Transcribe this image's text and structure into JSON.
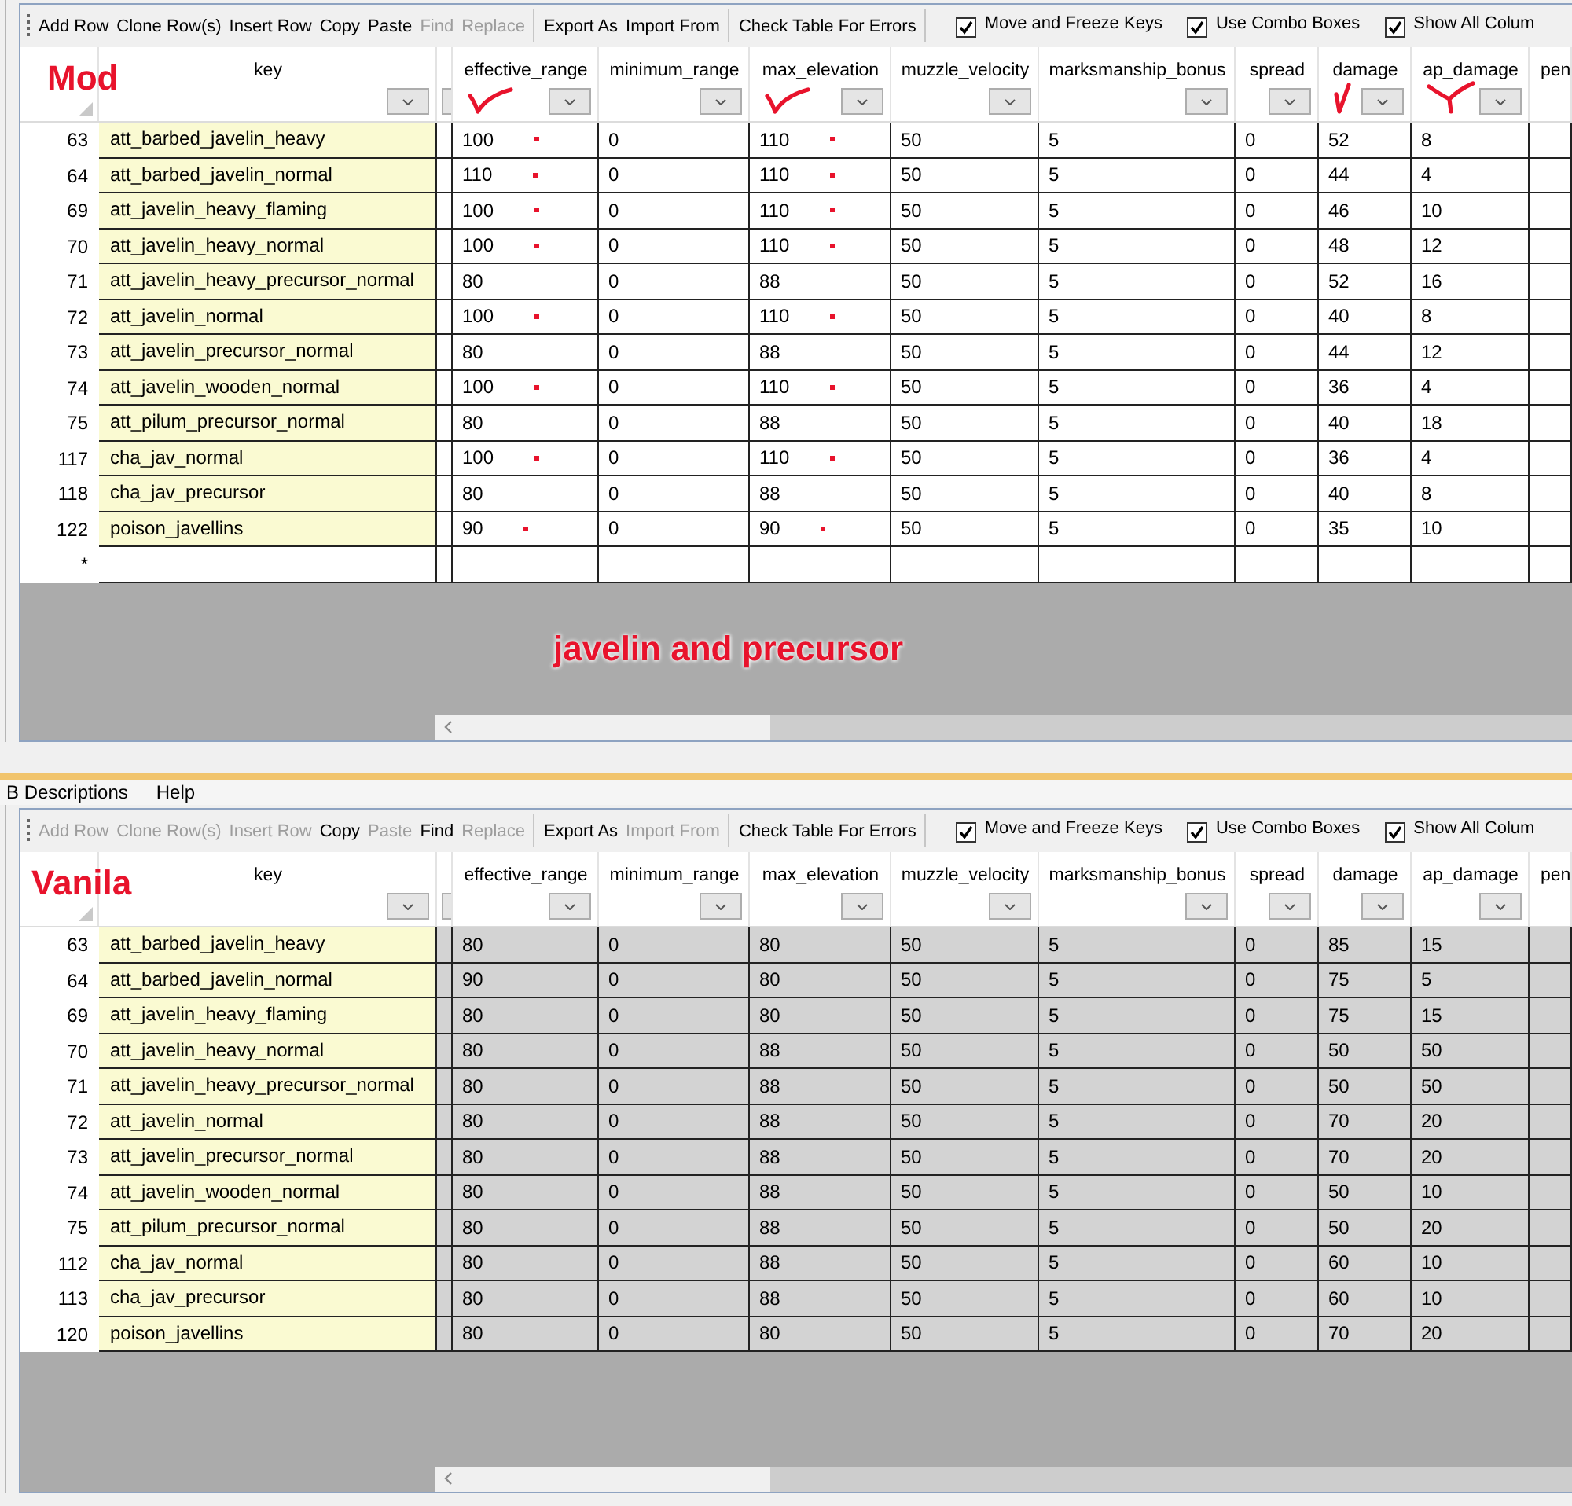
{
  "sections": [
    {
      "kind": "table_panel",
      "annotation": "Mod",
      "read_only": false,
      "toolbar": {
        "groups": [
          [
            {
              "label": "Add Row",
              "disabled": false
            },
            {
              "label": "Clone Row(s)",
              "disabled": false
            },
            {
              "label": "Insert Row",
              "disabled": false
            },
            {
              "label": "Copy",
              "disabled": false
            },
            {
              "label": "Paste",
              "disabled": false
            },
            {
              "label": "Find",
              "disabled": true
            },
            {
              "label": "Replace",
              "disabled": true
            }
          ],
          [
            {
              "label": "Export As",
              "disabled": false
            },
            {
              "label": "Import From",
              "disabled": false
            }
          ],
          [
            {
              "label": "Check Table For Errors",
              "disabled": false
            }
          ]
        ],
        "checkboxes": [
          {
            "label": "Move and Freeze Keys",
            "checked": true
          },
          {
            "label": "Use Combo Boxes",
            "checked": true
          },
          {
            "label": "Show All Colum",
            "checked": true
          }
        ]
      },
      "columns": [
        {
          "kind": "key",
          "label": "key",
          "filter": true
        },
        {
          "kind": "blank",
          "filter": true
        },
        {
          "kind": "value",
          "label": "effective_range",
          "filter": true,
          "mark": {
            "kind": "tick"
          }
        },
        {
          "kind": "value",
          "label": "minimum_range",
          "filter": true
        },
        {
          "kind": "value",
          "label": "max_elevation",
          "filter": true,
          "mark": {
            "kind": "tick"
          }
        },
        {
          "kind": "value",
          "label": "muzzle_velocity",
          "filter": true
        },
        {
          "kind": "value",
          "label": "marksmanship_bonus",
          "filter": true
        },
        {
          "kind": "value",
          "label": "spread",
          "filter": true
        },
        {
          "kind": "value",
          "label": "damage",
          "filter": true,
          "mark": {
            "kind": "slash"
          }
        },
        {
          "kind": "value",
          "label": "ap_damage",
          "filter": true,
          "mark": {
            "kind": "fork"
          }
        },
        {
          "kind": "blank",
          "label": "pen",
          "filter": false
        }
      ],
      "rows": [
        {
          "number": "63",
          "key": "att_barbed_javelin_heavy",
          "values": [
            "100",
            "0",
            "110",
            "50",
            "5",
            "0",
            "52",
            "8"
          ],
          "marked": true
        },
        {
          "number": "64",
          "key": "att_barbed_javelin_normal",
          "values": [
            "110",
            "0",
            "110",
            "50",
            "5",
            "0",
            "44",
            "4"
          ],
          "marked": true
        },
        {
          "number": "69",
          "key": "att_javelin_heavy_flaming",
          "values": [
            "100",
            "0",
            "110",
            "50",
            "5",
            "0",
            "46",
            "10"
          ],
          "marked": true
        },
        {
          "number": "70",
          "key": "att_javelin_heavy_normal",
          "values": [
            "100",
            "0",
            "110",
            "50",
            "5",
            "0",
            "48",
            "12"
          ],
          "marked": true
        },
        {
          "number": "71",
          "key": "att_javelin_heavy_precursor_normal",
          "values": [
            "80",
            "0",
            "88",
            "50",
            "5",
            "0",
            "52",
            "16"
          ],
          "marked": false
        },
        {
          "number": "72",
          "key": "att_javelin_normal",
          "values": [
            "100",
            "0",
            "110",
            "50",
            "5",
            "0",
            "40",
            "8"
          ],
          "marked": true
        },
        {
          "number": "73",
          "key": "att_javelin_precursor_normal",
          "values": [
            "80",
            "0",
            "88",
            "50",
            "5",
            "0",
            "44",
            "12"
          ],
          "marked": false
        },
        {
          "number": "74",
          "key": "att_javelin_wooden_normal",
          "values": [
            "100",
            "0",
            "110",
            "50",
            "5",
            "0",
            "36",
            "4"
          ],
          "marked": true
        },
        {
          "number": "75",
          "key": "att_pilum_precursor_normal",
          "values": [
            "80",
            "0",
            "88",
            "50",
            "5",
            "0",
            "40",
            "18"
          ],
          "marked": false
        },
        {
          "number": "117",
          "key": "cha_jav_normal",
          "values": [
            "100",
            "0",
            "110",
            "50",
            "5",
            "0",
            "36",
            "4"
          ],
          "marked": true
        },
        {
          "number": "118",
          "key": "cha_jav_precursor",
          "values": [
            "80",
            "0",
            "88",
            "50",
            "5",
            "0",
            "40",
            "8"
          ],
          "marked": false
        },
        {
          "number": "122",
          "key": "poison_javellins",
          "values": [
            "90",
            "0",
            "90",
            "50",
            "5",
            "0",
            "35",
            "10"
          ],
          "marked": true
        }
      ],
      "new_row": {
        "marker": "*"
      },
      "note": "javelin and precursor"
    },
    {
      "kind": "menu_strip",
      "items": [
        {
          "label": "B Descriptions"
        },
        {
          "label": "Help"
        }
      ]
    },
    {
      "kind": "table_panel",
      "annotation": "Vanila",
      "read_only": true,
      "toolbar": {
        "groups": [
          [
            {
              "label": "Add Row",
              "disabled": true
            },
            {
              "label": "Clone Row(s)",
              "disabled": true
            },
            {
              "label": "Insert Row",
              "disabled": true
            },
            {
              "label": "Copy",
              "disabled": false
            },
            {
              "label": "Paste",
              "disabled": true
            },
            {
              "label": "Find",
              "disabled": false
            },
            {
              "label": "Replace",
              "disabled": true
            }
          ],
          [
            {
              "label": "Export As",
              "disabled": false
            },
            {
              "label": "Import From",
              "disabled": true
            }
          ],
          [
            {
              "label": "Check Table For Errors",
              "disabled": false
            }
          ]
        ],
        "checkboxes": [
          {
            "label": "Move and Freeze Keys",
            "checked": true
          },
          {
            "label": "Use Combo Boxes",
            "checked": true
          },
          {
            "label": "Show All Colum",
            "checked": true
          }
        ]
      },
      "columns": [
        {
          "kind": "key",
          "label": "key",
          "filter": true
        },
        {
          "kind": "blank",
          "filter": true
        },
        {
          "kind": "value",
          "label": "effective_range",
          "filter": true
        },
        {
          "kind": "value",
          "label": "minimum_range",
          "filter": true
        },
        {
          "kind": "value",
          "label": "max_elevation",
          "filter": true
        },
        {
          "kind": "value",
          "label": "muzzle_velocity",
          "filter": true
        },
        {
          "kind": "value",
          "label": "marksmanship_bonus",
          "filter": true
        },
        {
          "kind": "value",
          "label": "spread",
          "filter": true
        },
        {
          "kind": "value",
          "label": "damage",
          "filter": true
        },
        {
          "kind": "value",
          "label": "ap_damage",
          "filter": true
        },
        {
          "kind": "blank",
          "label": "pen",
          "filter": false
        }
      ],
      "rows": [
        {
          "number": "63",
          "key": "att_barbed_javelin_heavy",
          "values": [
            "80",
            "0",
            "80",
            "50",
            "5",
            "0",
            "85",
            "15"
          ]
        },
        {
          "number": "64",
          "key": "att_barbed_javelin_normal",
          "values": [
            "90",
            "0",
            "80",
            "50",
            "5",
            "0",
            "75",
            "5"
          ]
        },
        {
          "number": "69",
          "key": "att_javelin_heavy_flaming",
          "values": [
            "80",
            "0",
            "80",
            "50",
            "5",
            "0",
            "75",
            "15"
          ]
        },
        {
          "number": "70",
          "key": "att_javelin_heavy_normal",
          "values": [
            "80",
            "0",
            "88",
            "50",
            "5",
            "0",
            "50",
            "50"
          ]
        },
        {
          "number": "71",
          "key": "att_javelin_heavy_precursor_normal",
          "values": [
            "80",
            "0",
            "88",
            "50",
            "5",
            "0",
            "50",
            "50"
          ]
        },
        {
          "number": "72",
          "key": "att_javelin_normal",
          "values": [
            "80",
            "0",
            "88",
            "50",
            "5",
            "0",
            "70",
            "20"
          ]
        },
        {
          "number": "73",
          "key": "att_javelin_precursor_normal",
          "values": [
            "80",
            "0",
            "88",
            "50",
            "5",
            "0",
            "70",
            "20"
          ]
        },
        {
          "number": "74",
          "key": "att_javelin_wooden_normal",
          "values": [
            "80",
            "0",
            "88",
            "50",
            "5",
            "0",
            "50",
            "10"
          ]
        },
        {
          "number": "75",
          "key": "att_pilum_precursor_normal",
          "values": [
            "80",
            "0",
            "88",
            "50",
            "5",
            "0",
            "50",
            "20"
          ]
        },
        {
          "number": "112",
          "key": "cha_jav_normal",
          "values": [
            "80",
            "0",
            "88",
            "50",
            "5",
            "0",
            "60",
            "10"
          ]
        },
        {
          "number": "113",
          "key": "cha_jav_precursor",
          "values": [
            "80",
            "0",
            "88",
            "50",
            "5",
            "0",
            "60",
            "10"
          ]
        },
        {
          "number": "120",
          "key": "poison_javellins",
          "values": [
            "80",
            "0",
            "80",
            "50",
            "5",
            "0",
            "70",
            "20"
          ]
        }
      ]
    }
  ]
}
